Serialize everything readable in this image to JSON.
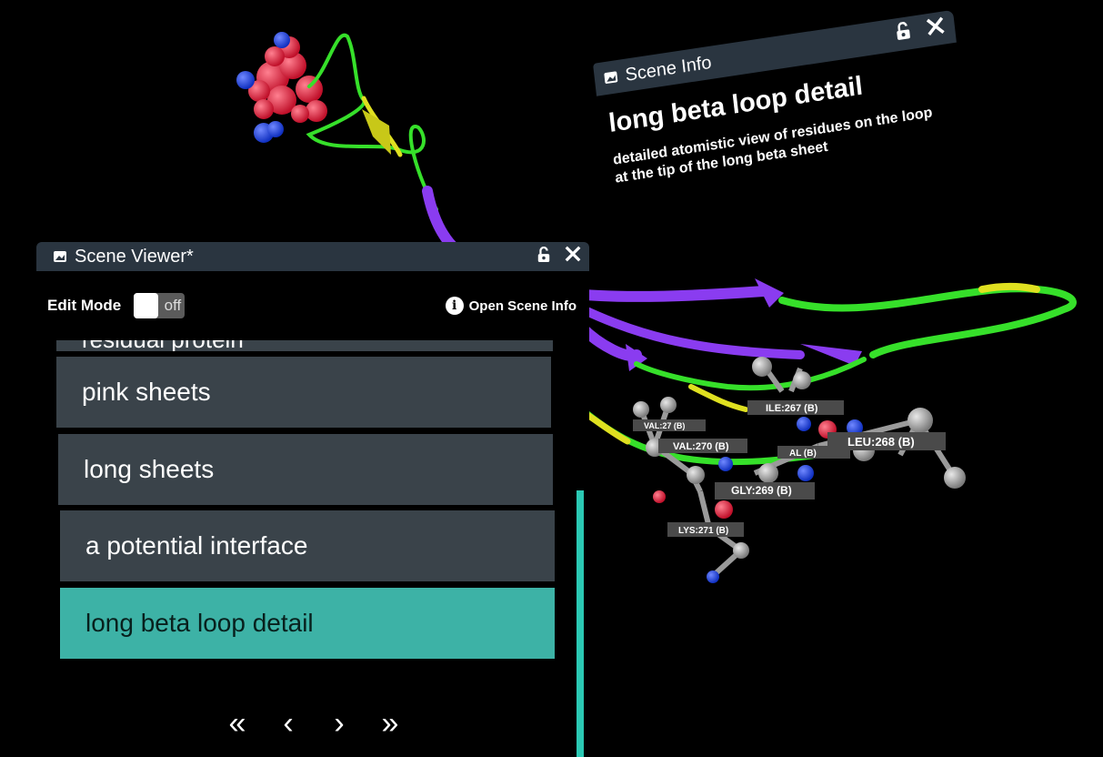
{
  "scene_info": {
    "header": "Scene Info",
    "title": "long beta loop detail",
    "description": "detailed atomistic view of residues on the loop at the tip of the long beta sheet",
    "lock_icon": "lock-open-icon",
    "close_icon": "close-icon"
  },
  "viewer": {
    "header": "Scene Viewer*",
    "edit_mode_label": "Edit Mode",
    "edit_mode_state": "off",
    "open_info_label": "Open Scene Info",
    "cut_item": "residual protein",
    "items": [
      "pink sheets",
      "long sheets",
      "a potential interface",
      "long beta loop detail"
    ],
    "selected_index": 3,
    "pager": {
      "first": "«",
      "prev": "‹",
      "next": "›",
      "last": "»"
    }
  },
  "residue_labels": [
    "ILE:267 (B)",
    "VAL:270 (B)",
    "VAL:27 (B)",
    "LEU:268 (B)",
    "AL (B)",
    "GLY:269 (B)",
    "LYS:271 (B)"
  ],
  "colors": {
    "panel_bar": "#2a3540",
    "list_item": "#3a434a",
    "selected": "#3db2a6",
    "ribbon_purple": "#8a3cf0",
    "ribbon_green": "#36e02a",
    "ribbon_yellow": "#dfe020",
    "atom_red": "#e8283c",
    "atom_blue": "#2244dd",
    "atom_gray": "#9a9a9a"
  }
}
